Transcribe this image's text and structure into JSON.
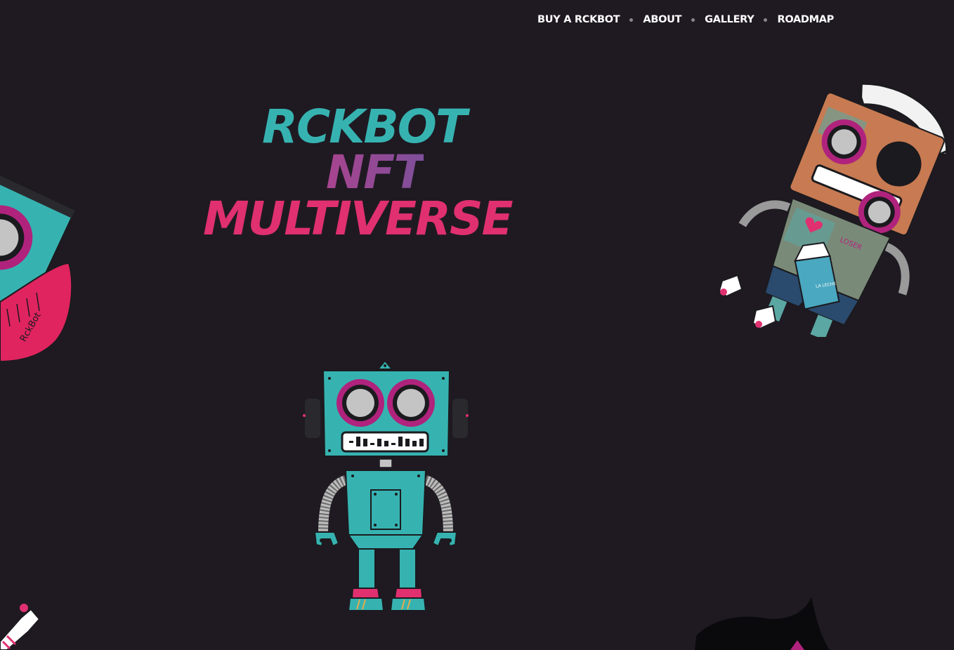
{
  "nav": {
    "items": [
      {
        "label": "BUY A RCKBOT"
      },
      {
        "label": "ABOUT"
      },
      {
        "label": "GALLERY"
      },
      {
        "label": "ROADMAP"
      }
    ]
  },
  "hero": {
    "line1": "RCKBOT",
    "line2": "NFT",
    "line3": "MULTIVERSE"
  },
  "colors": {
    "background": "#1f1a22",
    "teal": "#36b3b1",
    "purple": "#9c4a95",
    "pink": "#e0306f",
    "magenta": "#b0237d"
  },
  "decor": {
    "left_robot_text": "RckBot",
    "carton_label": "LA LECHE",
    "box_text": "LOSER"
  }
}
